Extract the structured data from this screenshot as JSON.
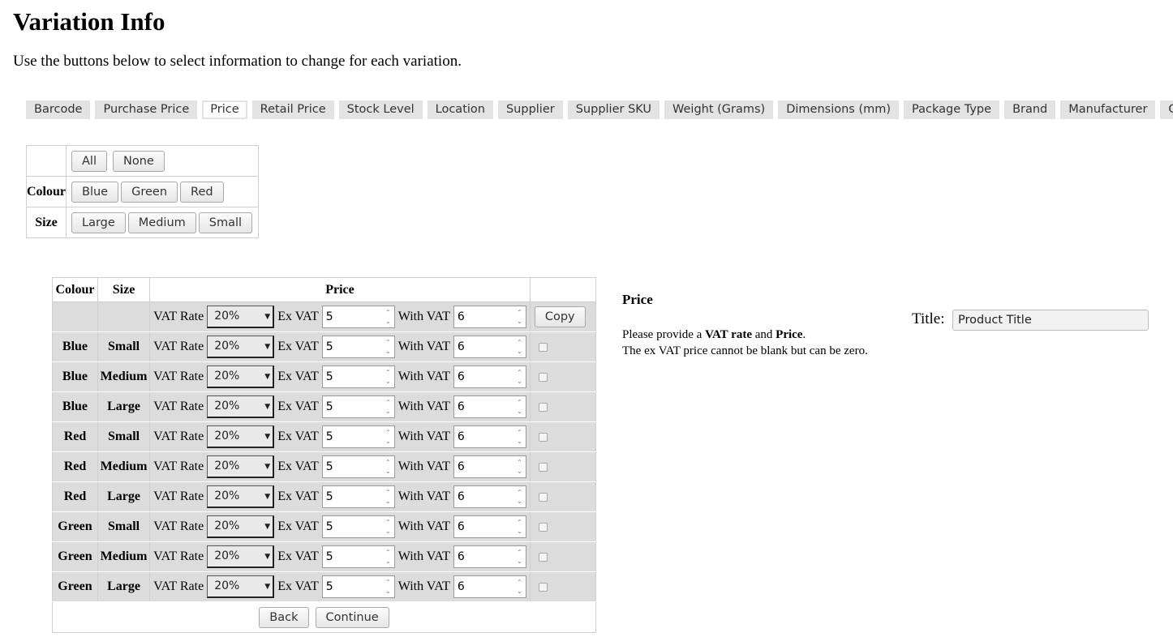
{
  "page": {
    "title": "Variation Info",
    "intro": "Use the buttons below to select information to change for each variation."
  },
  "tabs": [
    {
      "label": "Barcode",
      "active": false
    },
    {
      "label": "Purchase Price",
      "active": false
    },
    {
      "label": "Price",
      "active": true
    },
    {
      "label": "Retail Price",
      "active": false
    },
    {
      "label": "Stock Level",
      "active": false
    },
    {
      "label": "Location",
      "active": false
    },
    {
      "label": "Supplier",
      "active": false
    },
    {
      "label": "Supplier SKU",
      "active": false
    },
    {
      "label": "Weight (Grams)",
      "active": false
    },
    {
      "label": "Dimensions (mm)",
      "active": false
    },
    {
      "label": "Package Type",
      "active": false
    },
    {
      "label": "Brand",
      "active": false
    },
    {
      "label": "Manufacturer",
      "active": false
    },
    {
      "label": "Gender",
      "active": false
    }
  ],
  "filter": {
    "all_label": "All",
    "none_label": "None",
    "colour_label": "Colour",
    "colour_options": [
      "Blue",
      "Green",
      "Red"
    ],
    "size_label": "Size",
    "size_options": [
      "Large",
      "Medium",
      "Small"
    ]
  },
  "price_table": {
    "headers": {
      "colour": "Colour",
      "size": "Size",
      "price": "Price"
    },
    "labels": {
      "vat_rate": "VAT Rate",
      "ex_vat": "Ex VAT",
      "with_vat": "With VAT"
    },
    "all_row": {
      "vat_rate": "20%",
      "ex_vat": "5",
      "with_vat": "6",
      "copy_label": "Copy"
    },
    "rows": [
      {
        "colour": "Blue",
        "size": "Small",
        "vat_rate": "20%",
        "ex_vat": "5",
        "with_vat": "6"
      },
      {
        "colour": "Blue",
        "size": "Medium",
        "vat_rate": "20%",
        "ex_vat": "5",
        "with_vat": "6"
      },
      {
        "colour": "Blue",
        "size": "Large",
        "vat_rate": "20%",
        "ex_vat": "5",
        "with_vat": "6"
      },
      {
        "colour": "Red",
        "size": "Small",
        "vat_rate": "20%",
        "ex_vat": "5",
        "with_vat": "6"
      },
      {
        "colour": "Red",
        "size": "Medium",
        "vat_rate": "20%",
        "ex_vat": "5",
        "with_vat": "6"
      },
      {
        "colour": "Red",
        "size": "Large",
        "vat_rate": "20%",
        "ex_vat": "5",
        "with_vat": "6"
      },
      {
        "colour": "Green",
        "size": "Small",
        "vat_rate": "20%",
        "ex_vat": "5",
        "with_vat": "6"
      },
      {
        "colour": "Green",
        "size": "Medium",
        "vat_rate": "20%",
        "ex_vat": "5",
        "with_vat": "6"
      },
      {
        "colour": "Green",
        "size": "Large",
        "vat_rate": "20%",
        "ex_vat": "5",
        "with_vat": "6"
      }
    ],
    "back_label": "Back",
    "continue_label": "Continue"
  },
  "info": {
    "heading": "Price",
    "line1_pre": "Please provide a ",
    "line1_b1": "VAT rate",
    "line1_mid": " and ",
    "line1_b2": "Price",
    "line1_post": ".",
    "line2": "The ex VAT price cannot be blank but can be zero."
  },
  "title_field": {
    "label": "Title:",
    "value": "Product Title"
  },
  "colors": {
    "tab_bg": "#e3e3e3",
    "row_bg": "#dcdcdc",
    "border": "#cfcfcf"
  }
}
